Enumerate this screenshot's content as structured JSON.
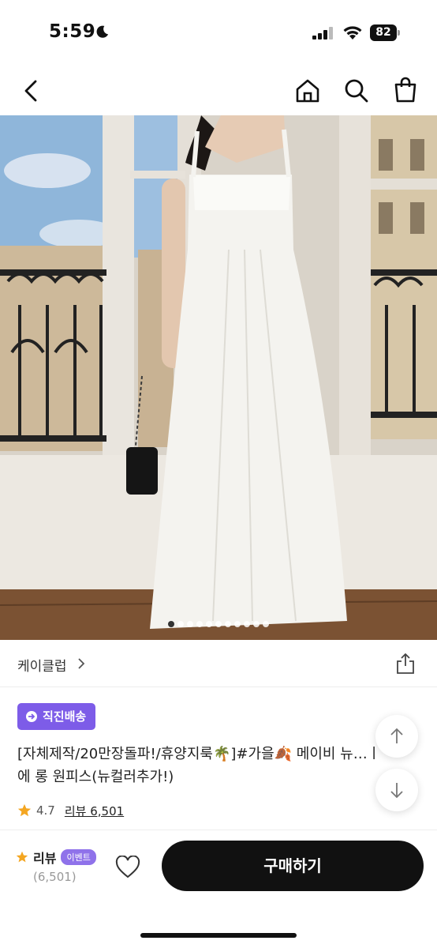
{
  "status_bar": {
    "time": "5:59",
    "battery": "82"
  },
  "brand": {
    "name": "케이클럽",
    "chevron": "›"
  },
  "product": {
    "badge": "직진배송",
    "title_line1": "[자체제작/20만장돌파!/휴양지룩🌴]#가을🍂 메이비 뉴…ㅣ",
    "title_line2": "에 롱 원피스(뉴컬러추가!)",
    "rating": "4.7",
    "review_text": "리뷰 6,501"
  },
  "carousel": {
    "count": 11,
    "active": 0
  },
  "bottom_bar": {
    "review_label": "리뷰",
    "event_badge": "이벤트",
    "review_count": "(6,501)",
    "buy_label": "구매하기"
  },
  "colors": {
    "accent": "#7d5ce8",
    "star": "#f4a621",
    "button": "#111111"
  }
}
